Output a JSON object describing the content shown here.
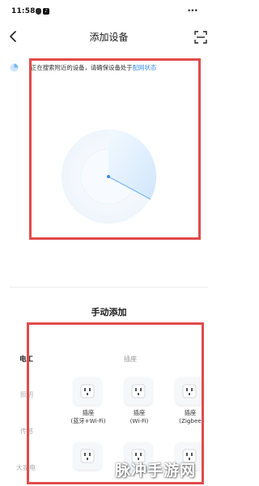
{
  "status_bar": {
    "time": "11:58",
    "more": "•••"
  },
  "header": {
    "title": "添加设备"
  },
  "search_hint": {
    "text": "正在搜索附近的设备，请确保设备处于",
    "link": "配网状态"
  },
  "manual": {
    "title": "手动添加"
  },
  "categories": [
    {
      "label": "电工",
      "active": true
    },
    {
      "label": "照明",
      "active": false
    },
    {
      "label": "传感",
      "active": false
    },
    {
      "label": "大家电",
      "active": false
    }
  ],
  "group": {
    "title": "插座"
  },
  "devices": [
    {
      "line1": "插座",
      "line2": "(蓝牙+Wi-Fi)"
    },
    {
      "line1": "插座",
      "line2": "(Wi-Fi)"
    },
    {
      "line1": "插座",
      "line2": "(Zigbee"
    },
    {
      "line1": "",
      "line2": ""
    },
    {
      "line1": "",
      "line2": ""
    },
    {
      "line1": "",
      "line2": ""
    }
  ],
  "watermark": {
    "text": "脉冲手游网"
  },
  "colors": {
    "accent": "#3a8ee6",
    "highlight": "#e14b4b"
  }
}
